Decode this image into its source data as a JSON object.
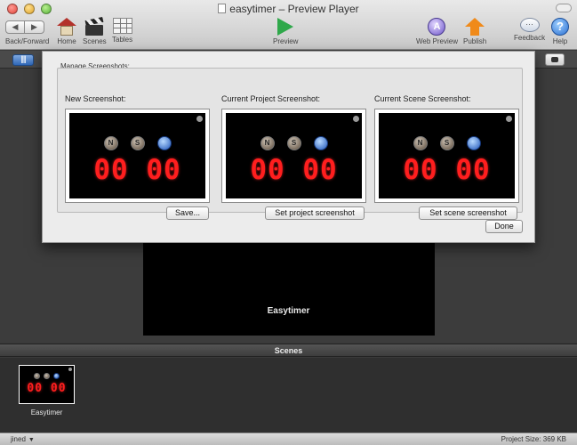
{
  "window": {
    "title": "easytimer – Preview Player"
  },
  "toolbar": {
    "back_forward_label": "Back/Forward",
    "home_label": "Home",
    "scenes_label": "Scenes",
    "tables_label": "Tables",
    "preview_label": "Preview",
    "web_preview_label": "Web Preview",
    "publish_label": "Publish",
    "feedback_label": "Feedback",
    "help_label": "Help",
    "back_arrow": "◀",
    "forward_arrow": "▶",
    "help_glyph": "?"
  },
  "dialog": {
    "legend": "Manage Screenshots:",
    "columns": [
      {
        "label": "New Screenshot:",
        "button": "Save..."
      },
      {
        "label": "Current Project Screenshot:",
        "button": "Set project screenshot"
      },
      {
        "label": "Current Scene Screenshot:",
        "button": "Set scene screenshot"
      }
    ],
    "done_button": "Done"
  },
  "timer": {
    "digits": "00 00",
    "icon_letters": [
      "N",
      "S"
    ],
    "digit_color": "#ff1e1e"
  },
  "stage": {
    "project_name": "Easytimer"
  },
  "scenes": {
    "header": "Scenes",
    "items": [
      {
        "label": "Easytimer"
      }
    ]
  },
  "status": {
    "user": "jined",
    "user_chevron": "▼",
    "project_size": "Project Size: 369 KB"
  },
  "icons": {
    "back": "chevron-left-icon",
    "forward": "chevron-right-icon",
    "home": "house-icon",
    "scenes": "clapperboard-icon",
    "tables": "table-icon",
    "preview": "play-icon",
    "web_preview": "globe-icon",
    "publish": "upload-arrow-icon",
    "feedback": "speech-bubble-icon",
    "help": "help-icon",
    "screenshot": "camera-icon"
  }
}
